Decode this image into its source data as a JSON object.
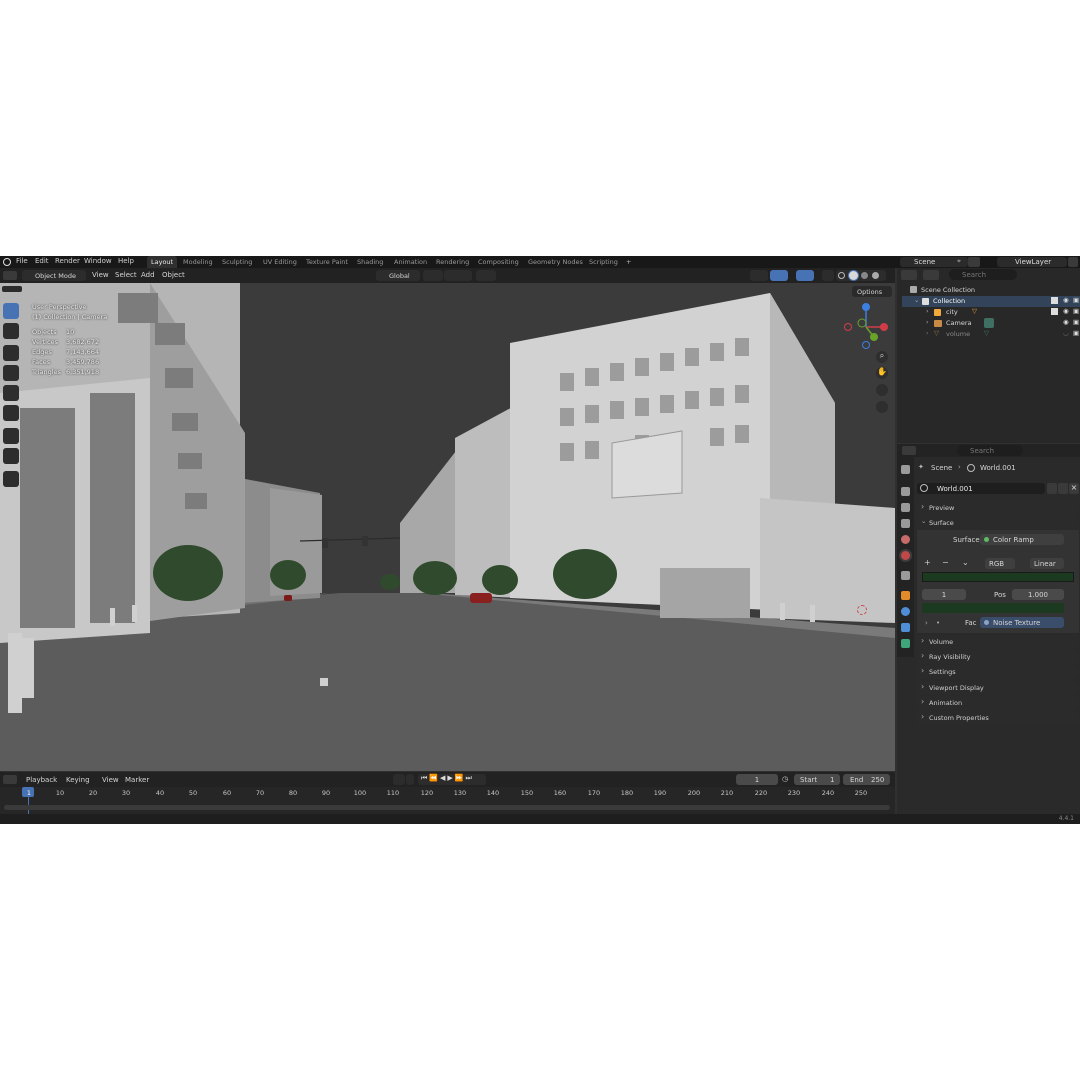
{
  "menu": [
    "File",
    "Edit",
    "Render",
    "Window",
    "Help"
  ],
  "workspaces": [
    "Layout",
    "Modeling",
    "Sculpting",
    "UV Editing",
    "Texture Paint",
    "Shading",
    "Animation",
    "Rendering",
    "Compositing",
    "Geometry Nodes",
    "Scripting"
  ],
  "add_tab": "+",
  "scene": "Scene",
  "view_layer": "ViewLayer",
  "viewport_header": {
    "mode": "Object Mode",
    "view": "View",
    "select": "Select",
    "add": "Add",
    "object": "Object",
    "orientation": "Global",
    "options": "Options"
  },
  "overlay": {
    "title": "User Perspective",
    "subtitle": "(1) Collection | Camera",
    "stats": [
      {
        "label": "Objects",
        "value": "10"
      },
      {
        "label": "Vertices",
        "value": "3,682,672"
      },
      {
        "label": "Edges",
        "value": "7,143,664"
      },
      {
        "label": "Faces",
        "value": "3,459,786"
      },
      {
        "label": "Triangles",
        "value": "6,351,918"
      }
    ]
  },
  "outliner": {
    "search": "Search",
    "root": "Scene Collection",
    "collection": "Collection",
    "items": [
      "city",
      "Camera",
      "volume"
    ]
  },
  "properties": {
    "search": "Search",
    "breadcrumb_scene": "Scene",
    "breadcrumb_world": "World.001",
    "world_name": "World.001",
    "preview": "Preview",
    "surface_panel": "Surface",
    "surface_label": "Surface",
    "surface_value": "Color Ramp",
    "color_mode": "RGB",
    "interpolation": "Linear",
    "stop_index": "1",
    "pos_label": "Pos",
    "pos_value": "1.000",
    "fac_label": "Fac",
    "fac_value": "Noise Texture",
    "panels": [
      "Volume",
      "Ray Visibility",
      "Settings",
      "Viewport Display",
      "Animation",
      "Custom Properties"
    ]
  },
  "timeline": {
    "playback": "Playback",
    "keying": "Keying",
    "view": "View",
    "marker": "Marker",
    "current_frame": "1",
    "start_label": "Start",
    "start_value": "1",
    "end_label": "End",
    "end_value": "250",
    "ticks": [
      "1",
      "10",
      "20",
      "30",
      "40",
      "50",
      "60",
      "70",
      "80",
      "90",
      "100",
      "110",
      "120",
      "130",
      "140",
      "150",
      "160",
      "170",
      "180",
      "190",
      "200",
      "210",
      "220",
      "230",
      "240",
      "250"
    ]
  },
  "version": "4.4.1",
  "colors": {
    "accent": "#4772b3",
    "ramp_color": "#1b3a1f",
    "background": "#303030"
  }
}
